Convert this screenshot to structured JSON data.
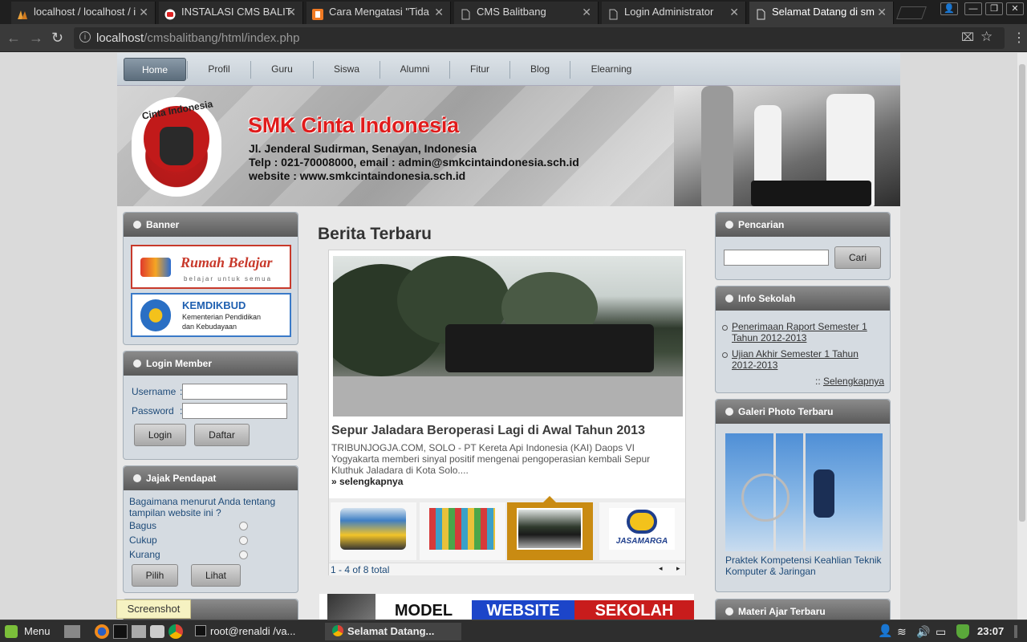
{
  "browser": {
    "tabs": [
      {
        "label": "localhost / localhost / i",
        "icon": "phpmyadmin-icon"
      },
      {
        "label": "INSTALASI CMS BALIT",
        "icon": "youtube-icon"
      },
      {
        "label": "Cara Mengatasi \"Tida",
        "icon": "blogger-icon"
      },
      {
        "label": "CMS Balitbang",
        "icon": "document-icon"
      },
      {
        "label": "Login Administrator",
        "icon": "document-icon"
      },
      {
        "label": "Selamat Datang di sm",
        "icon": "document-icon"
      }
    ],
    "url_host": "localhost",
    "url_path": "/cmsbalitbang/html/index.php"
  },
  "menu": [
    "Home",
    "Profil",
    "Guru",
    "Siswa",
    "Alumni",
    "Fitur",
    "Blog",
    "Elearning"
  ],
  "header": {
    "logo_text": "Cinta Indonesia",
    "school_name": "SMK Cinta Indonesia",
    "address": "Jl. Jenderal Sudirman, Senayan, Indonesia",
    "contact": "Telp : 021-70008000, email : admin@smkcintaindonesia.sch.id",
    "website": "website : www.smkcintaindonesia.sch.id"
  },
  "left": {
    "banner_title": "Banner",
    "banner1_title": "Rumah Belajar",
    "banner1_sub": "belajar untuk semua",
    "banner2_title": "KEMDIKBUD",
    "banner2_sub1": "Kementerian Pendidikan",
    "banner2_sub2": "dan Kebudayaan",
    "login_title": "Login Member",
    "username_label": "Username",
    "password_label": "Password",
    "colon": ":",
    "login_btn": "Login",
    "register_btn": "Daftar",
    "poll_title": "Jajak Pendapat",
    "poll_question": "Bagaimana menurut Anda tentang tampilan website ini ?",
    "poll_options": [
      "Bagus",
      "Cukup",
      "Kurang"
    ],
    "vote_btn": "Pilih",
    "view_btn": "Lihat"
  },
  "center": {
    "title": "Berita Terbaru",
    "news_title": "Sepur Jaladara Beroperasi Lagi di Awal Tahun 2013",
    "news_snippet": "TRIBUNJOGJA.COM, SOLO - PT Kereta Api Indonesia (KAI) Daops VI Yogyakarta memberi sinyal positif mengenai pengoperasian kembali Sepur Kluthuk Jaladara di Kota Solo....",
    "news_more": "» selengkapnya",
    "thumb4_text": "JASAMARGA",
    "pager": "1 - 4 of 8 total",
    "pager_prev": "◂",
    "pager_next": "▸",
    "model_banner": [
      "MODEL",
      "WEBSITE",
      "SEKOLAH"
    ]
  },
  "right": {
    "search_title": "Pencarian",
    "search_value": "",
    "search_btn": "Cari",
    "info_title": "Info Sekolah",
    "info_items": [
      "Penerimaan Raport Semester 1 Tahun 2012-2013",
      "Ujian Akhir Semester 1 Tahun 2012-2013"
    ],
    "info_more_prefix": "::",
    "info_more": "Selengkapnya",
    "gallery_title": "Galeri Photo Terbaru",
    "gallery_caption": "Praktek Kompetensi Keahlian Teknik Komputer & Jaringan",
    "material_title": "Materi Ajar Terbaru"
  },
  "tooltip": "Screenshot",
  "taskbar": {
    "menu": "Menu",
    "terminal": "root@renaldi /va...",
    "browser": "Selamat Datang...",
    "time": "23:07"
  }
}
